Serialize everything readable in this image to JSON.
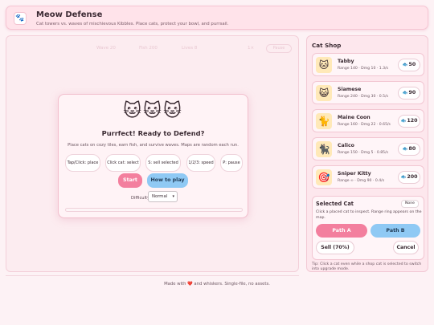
{
  "header": {
    "logo_icon": "🐾",
    "title": "Meow Defense",
    "subtitle": "Cat towers vs. waves of mischievous Kibbles. Place cats, protect your bowl, and purrsail."
  },
  "hud": {
    "wave": "Wave 20",
    "fish": "Fish 200",
    "lives": "Lives 8",
    "speed": "1×",
    "pause_label": "Pause"
  },
  "modal": {
    "cats": "🐱🐱🐱",
    "title": "Purrfect! Ready to Defend?",
    "description": "Place cats on cozy tiles, earn fish, and survive waves. Maps are random each run.",
    "keys": [
      {
        "label": "Tap/Click: place"
      },
      {
        "label": "Click cat: select"
      },
      {
        "label": "S: sell selected"
      },
      {
        "label": "1/2/3: speed"
      },
      {
        "label": "P: pause"
      }
    ],
    "start_label": "Start",
    "howto_label": "How to play",
    "difficulty_label": "Difficulty",
    "difficulty_value": "Normal",
    "difficulty_options": [
      "Normal"
    ]
  },
  "footer": "Made with ❤️ and whiskers. Single-file, no assets.",
  "shop": {
    "title": "Cat Shop",
    "currency_icon": "fish-icon",
    "items": [
      {
        "name": "Tabby",
        "stats": "Range 140 · Dmg 10 · 1.3/s",
        "price": "50",
        "icon": "🐱"
      },
      {
        "name": "Siamese",
        "stats": "Range 240 · Dmg 30 · 0.5/s",
        "price": "90",
        "icon": "😺"
      },
      {
        "name": "Maine Coon",
        "stats": "Range 160 · Dmg 22 · 0.65/s",
        "price": "120",
        "icon": "🐈"
      },
      {
        "name": "Calico",
        "stats": "Range 150 · Dmg 5 · 0.85/s",
        "price": "80",
        "icon": "🐈‍⬛"
      },
      {
        "name": "Sniper Kitty",
        "stats": "Range ∞ · Dmg 90 · 0.4/s",
        "price": "200",
        "icon": "🎯"
      }
    ]
  },
  "selected": {
    "title": "Selected Cat",
    "note": "None",
    "text": "Click a placed cat to inspect. Range ring appears on the map.",
    "path_a": "Path A",
    "path_b": "Path B",
    "sell": "Sell (70%)",
    "cancel": "Cancel"
  },
  "tip": "Tip: Click a cat even while a shop cat is selected to switch into upgrade mode.",
  "colors": {
    "pink_accent": "#f37f9e",
    "blue_accent": "#8fc9f4",
    "background": "#fdf2f5"
  }
}
